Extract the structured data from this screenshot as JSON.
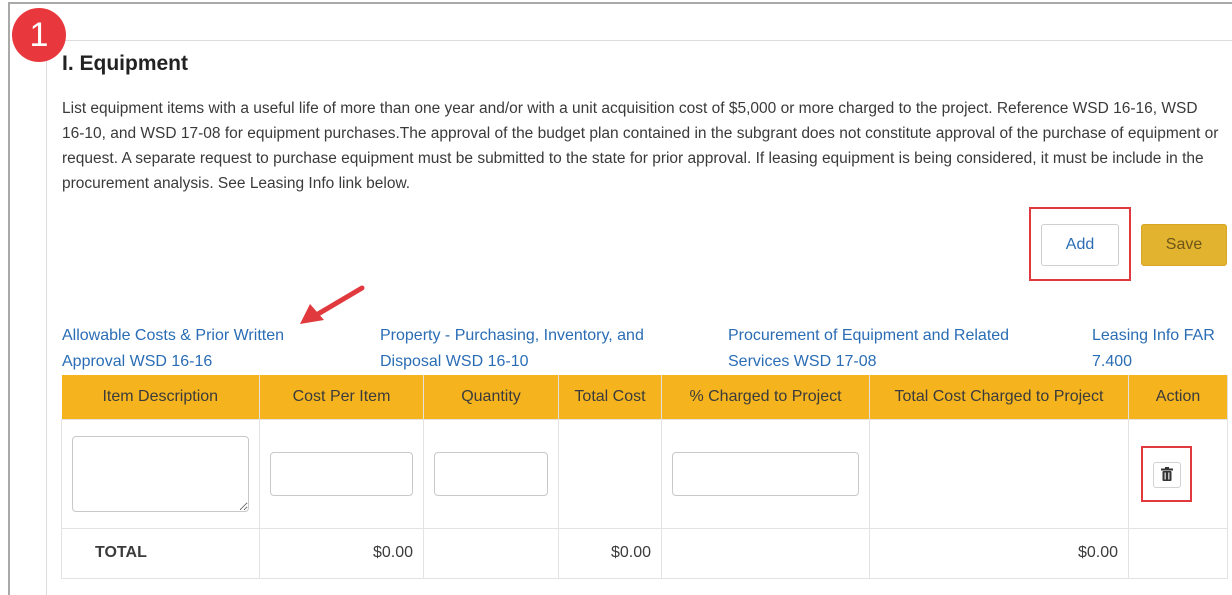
{
  "step_number": "1",
  "section": {
    "title": "I. Equipment",
    "description": "List equipment items with a useful life of more than one year and/or with a unit acquisition cost of $5,000 or more charged to the project. Reference WSD 16-16, WSD 16-10, and WSD 17-08 for equipment purchases.The approval of the budget plan contained in the subgrant does not constitute approval of the purchase of equipment or request. A separate request to purchase equipment must be submitted to the state for prior approval. If leasing equipment is being considered, it must be include in the procurement analysis. See Leasing Info link below."
  },
  "buttons": {
    "add": "Add",
    "save": "Save"
  },
  "links": [
    {
      "line1": "Allowable Costs & Prior Written",
      "line2": "Approval WSD 16-16"
    },
    {
      "line1": "Property - Purchasing, Inventory, and",
      "line2": "Disposal WSD 16-10"
    },
    {
      "line1": "Procurement of Equipment and Related",
      "line2": "Services WSD 17-08"
    },
    {
      "line1": "Leasing Info FAR",
      "line2": "7.400"
    }
  ],
  "table": {
    "headers": [
      "Item Description",
      "Cost Per Item",
      "Quantity",
      "Total Cost",
      "% Charged to Project",
      "Total Cost Charged to Project",
      "Action"
    ],
    "row": {
      "item_description": "",
      "cost_per_item": "",
      "quantity": "",
      "percent_charged": ""
    },
    "total": {
      "label": "TOTAL",
      "cost_per_item": "$0.00",
      "total_cost": "$0.00",
      "total_charged": "$0.00"
    }
  },
  "icons": {
    "delete": "trash-icon",
    "annotation_arrow": "arrow-icon"
  },
  "colors": {
    "header_bg": "#f5b41e",
    "save_bg": "#e2b32e",
    "link": "#2a6db5",
    "highlight": "#e0393e",
    "badge": "#e8383d"
  }
}
